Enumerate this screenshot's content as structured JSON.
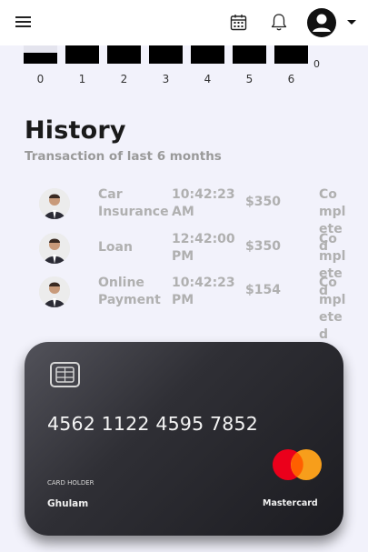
{
  "header": {
    "menu_icon": "hamburger-menu-icon",
    "calendar_icon": "calendar-icon",
    "notification_icon": "bell-icon",
    "profile_icon": "user-avatar-icon",
    "dropdown_icon": "caret-down-icon"
  },
  "chart_data": {
    "type": "bar",
    "categories": [
      "0",
      "1",
      "2",
      "3",
      "4",
      "5",
      "6"
    ],
    "y_tick_visible": "0",
    "bar_color": "#000000"
  },
  "history": {
    "title": "History",
    "subtitle": "Transaction of last 6 months",
    "transactions": [
      {
        "type": "Car Insurance",
        "time": "10:42:23 AM",
        "amount": "$350",
        "status": "Completed"
      },
      {
        "type": "Loan",
        "time": "12:42:00 PM",
        "amount": "$350",
        "status": "Completed"
      },
      {
        "type": "Online Payment",
        "time": "10:42:23 PM",
        "amount": "$154",
        "status": "Completed"
      }
    ]
  },
  "card": {
    "number": "4562 1122 4595 7852",
    "holder_label": "CARD HOLDER",
    "holder_name": "Ghulam",
    "brand": "Mastercard",
    "brand_colors": {
      "left": "#eb001b",
      "right": "#f79e1b"
    }
  }
}
